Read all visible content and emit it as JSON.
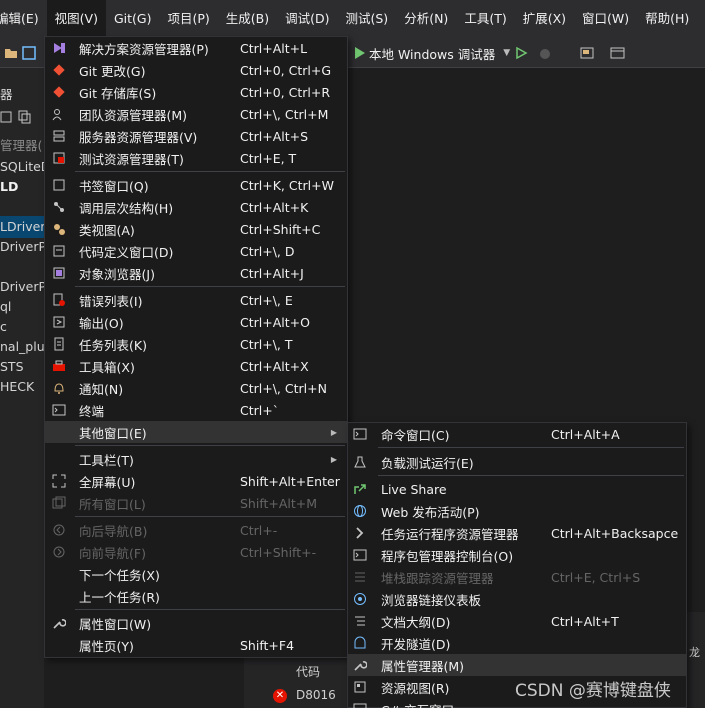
{
  "menubar": {
    "items": [
      {
        "label": "编辑(E)"
      },
      {
        "label": "视图(V)"
      },
      {
        "label": "Git(G)"
      },
      {
        "label": "项目(P)"
      },
      {
        "label": "生成(B)"
      },
      {
        "label": "调试(D)"
      },
      {
        "label": "测试(S)"
      },
      {
        "label": "分析(N)"
      },
      {
        "label": "工具(T)"
      },
      {
        "label": "扩展(X)"
      },
      {
        "label": "窗口(W)"
      },
      {
        "label": "帮助(H)"
      }
    ]
  },
  "toolbar": {
    "run_label": "本地 Windows 调试器"
  },
  "left_panel": {
    "rows": [
      "器",
      "管理器(",
      "SQLiteD",
      "LD",
      "LDriverF",
      "DriverPl",
      "DriverPl",
      "ql",
      "c",
      "nal_plug",
      "STS",
      "HECK"
    ]
  },
  "view_menu": {
    "items": [
      {
        "label": "解决方案资源管理器(P)",
        "shortcut": "Ctrl+Alt+L",
        "icon": "solution-explorer-icon"
      },
      {
        "label": "Git 更改(G)",
        "shortcut": "Ctrl+0, Ctrl+G",
        "icon": "git-changes-icon"
      },
      {
        "label": "Git 存储库(S)",
        "shortcut": "Ctrl+0, Ctrl+R",
        "icon": "git-repo-icon"
      },
      {
        "label": "团队资源管理器(M)",
        "shortcut": "Ctrl+\\, Ctrl+M",
        "icon": "team-explorer-icon"
      },
      {
        "label": "服务器资源管理器(V)",
        "shortcut": "Ctrl+Alt+S",
        "icon": "server-explorer-icon"
      },
      {
        "label": "测试资源管理器(T)",
        "shortcut": "Ctrl+E, T",
        "icon": "test-explorer-icon"
      },
      {
        "label": "书签窗口(Q)",
        "shortcut": "Ctrl+K, Ctrl+W",
        "icon": "bookmark-icon"
      },
      {
        "label": "调用层次结构(H)",
        "shortcut": "Ctrl+Alt+K",
        "icon": "call-hierarchy-icon"
      },
      {
        "label": "类视图(A)",
        "shortcut": "Ctrl+Shift+C",
        "icon": "class-view-icon"
      },
      {
        "label": "代码定义窗口(D)",
        "shortcut": "Ctrl+\\, D",
        "icon": "code-definition-icon"
      },
      {
        "label": "对象浏览器(J)",
        "shortcut": "Ctrl+Alt+J",
        "icon": "object-browser-icon"
      },
      {
        "label": "错误列表(I)",
        "shortcut": "Ctrl+\\, E",
        "icon": "error-list-icon"
      },
      {
        "label": "输出(O)",
        "shortcut": "Ctrl+Alt+O",
        "icon": "output-icon"
      },
      {
        "label": "任务列表(K)",
        "shortcut": "Ctrl+\\, T",
        "icon": "task-list-icon"
      },
      {
        "label": "工具箱(X)",
        "shortcut": "Ctrl+Alt+X",
        "icon": "toolbox-icon"
      },
      {
        "label": "通知(N)",
        "shortcut": "Ctrl+\\, Ctrl+N",
        "icon": "bell-icon"
      },
      {
        "label": "终端",
        "shortcut": "Ctrl+`",
        "icon": "terminal-icon"
      },
      {
        "label": "其他窗口(E)",
        "shortcut": "",
        "icon": ""
      },
      {
        "label": "工具栏(T)",
        "shortcut": "",
        "icon": ""
      },
      {
        "label": "全屏幕(U)",
        "shortcut": "Shift+Alt+Enter",
        "icon": "fullscreen-icon"
      },
      {
        "label": "所有窗口(L)",
        "shortcut": "Shift+Alt+M",
        "icon": "all-windows-icon"
      },
      {
        "label": "向后导航(B)",
        "shortcut": "Ctrl+-",
        "icon": "navigate-back-icon"
      },
      {
        "label": "向前导航(F)",
        "shortcut": "Ctrl+Shift+-",
        "icon": "navigate-forward-icon"
      },
      {
        "label": "下一个任务(X)",
        "shortcut": "",
        "icon": ""
      },
      {
        "label": "上一个任务(R)",
        "shortcut": "",
        "icon": ""
      },
      {
        "label": "属性窗口(W)",
        "shortcut": "F4",
        "icon": "wrench-icon"
      },
      {
        "label": "属性页(Y)",
        "shortcut": "Shift+F4",
        "icon": ""
      }
    ]
  },
  "other_windows_menu": {
    "items": [
      {
        "label": "命令窗口(C)",
        "shortcut": "Ctrl+Alt+A",
        "icon": "command-window-icon"
      },
      {
        "label": "负载测试运行(E)",
        "shortcut": "",
        "icon": "load-test-icon"
      },
      {
        "label": "Live Share",
        "shortcut": "",
        "icon": "live-share-icon"
      },
      {
        "label": "Web 发布活动(P)",
        "shortcut": "",
        "icon": "globe-icon"
      },
      {
        "label": "任务运行程序资源管理器",
        "shortcut": "Ctrl+Alt+Backsapce",
        "icon": "task-runner-icon"
      },
      {
        "label": "程序包管理器控制台(O)",
        "shortcut": "",
        "icon": "console-icon"
      },
      {
        "label": "堆栈跟踪资源管理器",
        "shortcut": "Ctrl+E, Ctrl+S",
        "icon": "stack-trace-icon"
      },
      {
        "label": "浏览器链接仪表板",
        "shortcut": "",
        "icon": "browser-link-icon"
      },
      {
        "label": "文档大纲(D)",
        "shortcut": "Ctrl+Alt+T",
        "icon": "document-outline-icon"
      },
      {
        "label": "开发隧道(D)",
        "shortcut": "",
        "icon": "dev-tunnel-icon"
      },
      {
        "label": "属性管理器(M)",
        "shortcut": "",
        "icon": "wrench-icon"
      },
      {
        "label": "资源视图(R)",
        "shortcut": "",
        "icon": "resource-view-icon"
      },
      {
        "label": "C# 交互窗口",
        "shortcut": "",
        "icon": "csharp-interactive-icon"
      }
    ]
  },
  "error_panel": {
    "column_header": "代码",
    "error_code": "D8016"
  },
  "right_strip": {
    "text": "龙"
  },
  "watermark": "CSDN @赛博键盘侠",
  "colors": {
    "menu_bg": "#1b1b1c",
    "menubar_bg": "#2d2d30",
    "highlight": "#333334",
    "disabled_text": "#656565",
    "accent_green": "#71c671"
  }
}
